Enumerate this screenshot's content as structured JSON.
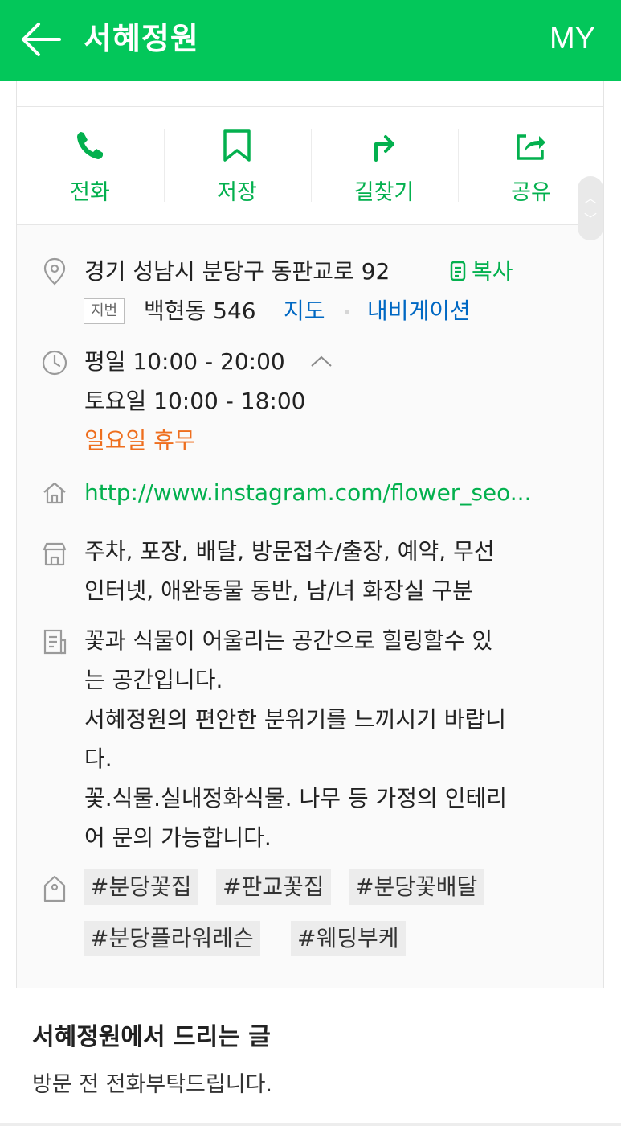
{
  "header": {
    "title": "서혜정원",
    "my_label": "MY"
  },
  "actions": [
    {
      "label": "전화"
    },
    {
      "label": "저장"
    },
    {
      "label": "길찾기"
    },
    {
      "label": "공유"
    }
  ],
  "address": {
    "road": "경기 성남시 분당구 동판교로 92",
    "copy_label": "복사",
    "jibun_badge": "지번",
    "jibun": "백현동 546",
    "map_link": "지도",
    "navi_link": "내비게이션"
  },
  "hours": {
    "weekday": "평일 10:00 - 20:00",
    "saturday": "토요일 10:00 - 18:00",
    "sunday": "일요일 휴무"
  },
  "website": "http://www.instagram.com/flower_seo...",
  "amenities": [
    "주차, 포장, 배달, 방문접수/출장, 예약, 무선",
    "인터넷, 애완동물 동반, 남/녀 화장실 구분"
  ],
  "description": [
    "꽃과 식물이 어울리는 공간으로 힐링할수 있",
    "는 공간입니다.",
    "서혜정원의 편안한 분위기를 느끼시기 바랍니",
    "다.",
    "꽃.식물.실내정화식물. 나무 등 가정의 인테리",
    "어 문의 가능합니다."
  ],
  "tags": [
    "#분당꽃집",
    "#판교꽃집",
    "#분당꽃배달",
    "#분당플라워레슨",
    "#웨딩부케"
  ],
  "notice": {
    "title": "서혜정원에서 드리는 글",
    "text": "방문 전 전화부탁드립니다."
  },
  "colors": {
    "brand": "#03c75a",
    "action_green": "#03b04e",
    "link_blue": "#0068c3",
    "closed_orange": "#ee6e1e"
  }
}
